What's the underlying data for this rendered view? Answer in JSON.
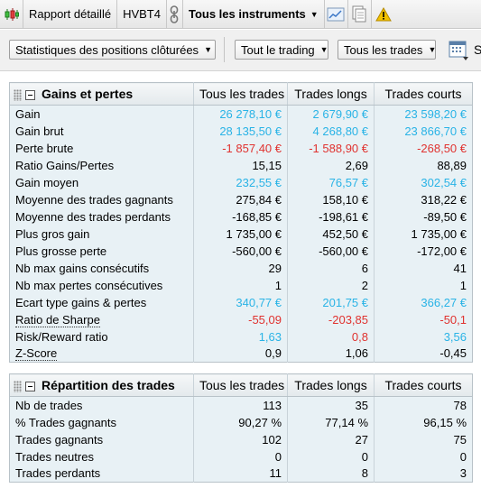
{
  "topbar": {
    "report_label": "Rapport détaillé",
    "account": "HVBT4",
    "instruments": "Tous les instruments",
    "icons": [
      "candlestick-chart-icon",
      "link-icon",
      "chart-icon",
      "documents-icon",
      "warning-icon"
    ]
  },
  "toolbar": {
    "stats_select": "Statistiques des positions clôturées",
    "trading_select": "Tout le trading",
    "trades_select": "Tous les trades",
    "extra_label": "S"
  },
  "columns": {
    "all": "Tous les trades",
    "long": "Trades longs",
    "short": "Trades courts"
  },
  "colors": {
    "positive": "#29b3e6",
    "negative": "#e0322f",
    "header_bg": "#e3e9ec",
    "row_bg": "#e8f1f5"
  },
  "gains": {
    "title": "Gains et pertes",
    "rows": [
      {
        "label": "Gain",
        "all": "26 278,10 €",
        "long": "2 679,90 €",
        "short": "23 598,20 €"
      },
      {
        "label": "Gain brut",
        "all": "28 135,50 €",
        "long": "4 268,80 €",
        "short": "23 866,70 €"
      },
      {
        "label": "Perte brute",
        "all": "-1 857,40 €",
        "long": "-1 588,90 €",
        "short": "-268,50 €"
      },
      {
        "label": "Ratio Gains/Pertes",
        "all": "15,15",
        "long": "2,69",
        "short": "88,89"
      },
      {
        "label": "Gain moyen",
        "all": "232,55 €",
        "long": "76,57 €",
        "short": "302,54 €"
      },
      {
        "label": "Moyenne des trades gagnants",
        "all": "275,84 €",
        "long": "158,10 €",
        "short": "318,22 €"
      },
      {
        "label": "Moyenne des trades perdants",
        "all": "-168,85 €",
        "long": "-198,61 €",
        "short": "-89,50 €"
      },
      {
        "label": "Plus gros gain",
        "all": "1 735,00 €",
        "long": "452,50 €",
        "short": "1 735,00 €"
      },
      {
        "label": "Plus grosse perte",
        "all": "-560,00 €",
        "long": "-560,00 €",
        "short": "-172,00 €"
      },
      {
        "label": "Nb max gains consécutifs",
        "all": "29",
        "long": "6",
        "short": "41"
      },
      {
        "label": "Nb max pertes consécutives",
        "all": "1",
        "long": "2",
        "short": "1"
      },
      {
        "label": "Ecart type gains & pertes",
        "all": "340,77 €",
        "long": "201,75 €",
        "short": "366,27 €"
      },
      {
        "label": "Ratio de Sharpe",
        "all": "-55,09",
        "long": "-203,85",
        "short": "-50,1"
      },
      {
        "label": "Risk/Reward ratio",
        "all": "1,63",
        "long": "0,8",
        "short": "3,56"
      },
      {
        "label": "Z-Score",
        "all": "0,9",
        "long": "1,06",
        "short": "-0,45"
      }
    ]
  },
  "repartition": {
    "title": "Répartition des trades",
    "rows": [
      {
        "label": "Nb de trades",
        "all": "113",
        "long": "35",
        "short": "78"
      },
      {
        "label": "% Trades gagnants",
        "all": "90,27 %",
        "long": "77,14 %",
        "short": "96,15 %"
      },
      {
        "label": "Trades gagnants",
        "all": "102",
        "long": "27",
        "short": "75"
      },
      {
        "label": "Trades neutres",
        "all": "0",
        "long": "0",
        "short": "0"
      },
      {
        "label": "Trades perdants",
        "all": "11",
        "long": "8",
        "short": "3"
      }
    ]
  }
}
